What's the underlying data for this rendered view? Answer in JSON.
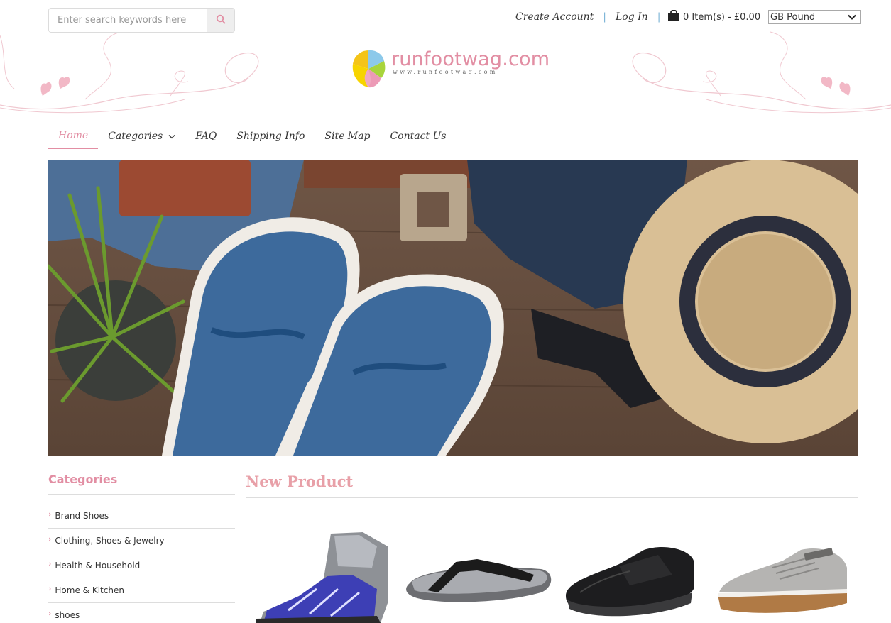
{
  "header": {
    "search": {
      "placeholder": "Enter search keywords here"
    },
    "links": {
      "create_account": "Create Account",
      "log_in": "Log In"
    },
    "cart": {
      "label": "0 Item(s) - £0.00"
    },
    "currency": {
      "selected": "GB Pound"
    },
    "logo": {
      "main": "runfootwag.com",
      "sub": "www.runfootwag.com"
    }
  },
  "nav": {
    "items": [
      {
        "label": "Home",
        "active": true
      },
      {
        "label": "Categories",
        "has_dropdown": true
      },
      {
        "label": "FAQ"
      },
      {
        "label": "Shipping Info"
      },
      {
        "label": "Site Map"
      },
      {
        "label": "Contact Us"
      }
    ]
  },
  "sidebar": {
    "title": "Categories",
    "items": [
      {
        "label": "Brand Shoes"
      },
      {
        "label": "Clothing, Shoes & Jewelry"
      },
      {
        "label": "Health & Household"
      },
      {
        "label": "Home & Kitchen"
      },
      {
        "label": "shoes"
      }
    ]
  },
  "main": {
    "title": "New Product",
    "products": [
      {
        "icon": "wrestling-shoe-image"
      },
      {
        "icon": "flip-flop-image"
      },
      {
        "icon": "black-shoe-image"
      },
      {
        "icon": "grey-sneaker-image"
      }
    ]
  },
  "colors": {
    "accent": "#e28ea3",
    "title_pink": "#e8a0a8",
    "separator_blue": "#7ab3d6"
  }
}
